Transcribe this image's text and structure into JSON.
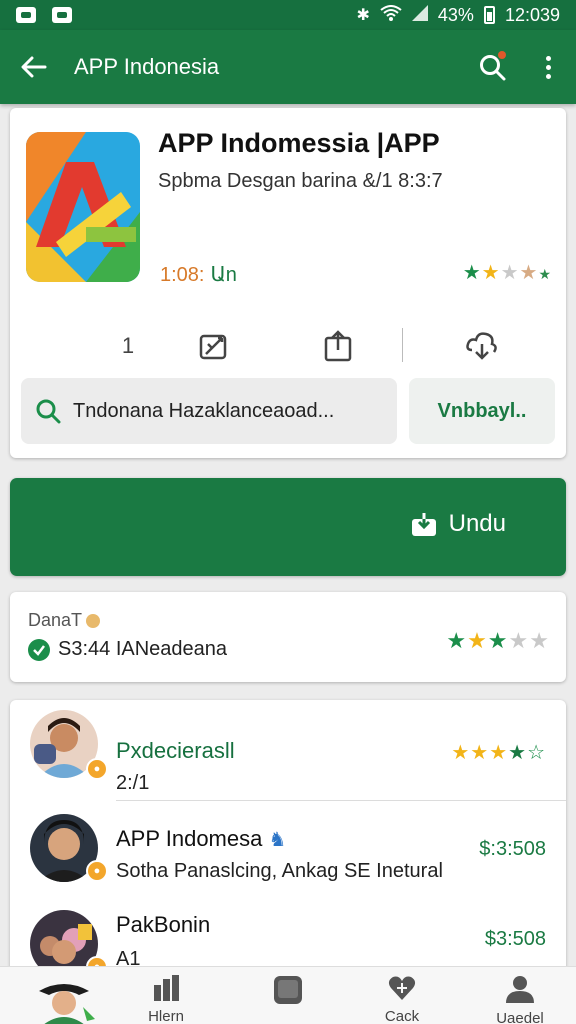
{
  "status_bar": {
    "battery_pct": "43%",
    "time": "12:039"
  },
  "app_bar": {
    "title": "APP Indonesia",
    "back_icon": "arrow-left-icon",
    "search_icon": "search-icon",
    "menu_icon": "more-vert-icon"
  },
  "app_card": {
    "title": "APP Indomessia |APP",
    "subtitle": "Spbma Desgan barina &/1 8:3:7",
    "size": "1:08:",
    "size_suffix": "Աn",
    "count": "1",
    "search_text": "Tndonana Hazaklanceaoad...",
    "cta_label": "Vnbbayl.."
  },
  "download": {
    "label": "Undu"
  },
  "rating_card": {
    "title": "DanaT",
    "line": "S3:44  IANeadeana"
  },
  "reviews": [
    {
      "name": "Pxdecierasll",
      "sub": "2:/1",
      "right": ""
    },
    {
      "name": "APP Indomesa",
      "sub": "Sotha Panaslcing, Ankag SE Inetural",
      "right": "$:3:508"
    },
    {
      "name": "PakBonin",
      "sub": "A1",
      "right": "$3:508"
    }
  ],
  "bottom_nav": [
    {
      "label": "",
      "icon": "avatar-icon"
    },
    {
      "label": "Hlern",
      "icon": "bar-chart-icon"
    },
    {
      "label": "",
      "icon": "square-icon"
    },
    {
      "label": "Cack",
      "icon": "heart-icon"
    },
    {
      "label": "Uaedel",
      "icon": "person-icon"
    }
  ],
  "colors": {
    "primary": "#1a7a43",
    "star_green": "#1b8e4a",
    "star_yellow": "#f2b418"
  }
}
